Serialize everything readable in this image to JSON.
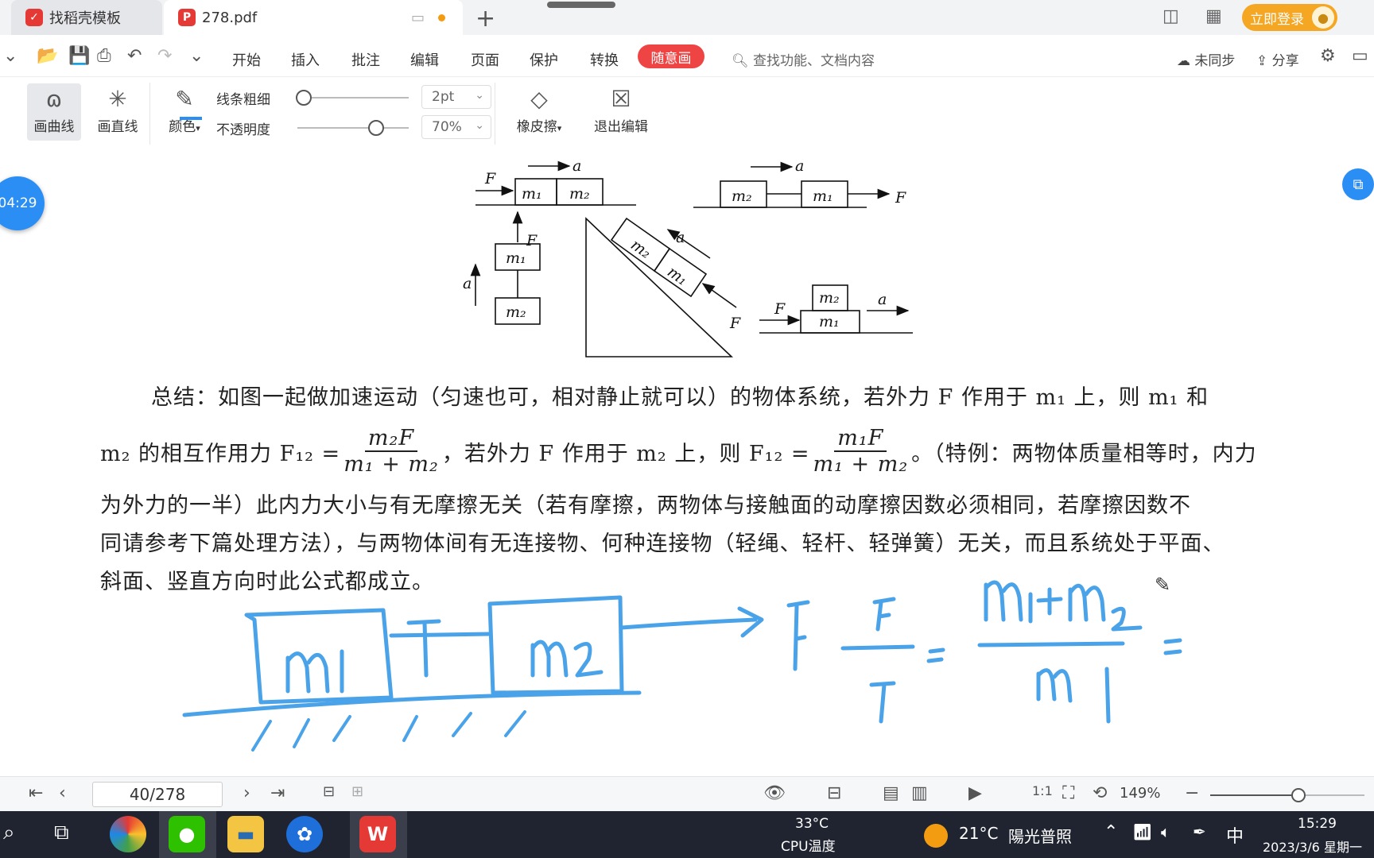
{
  "tabs": [
    {
      "label": "找稻壳模板",
      "icon": "docer-icon"
    },
    {
      "label": "278.pdf",
      "icon": "pdf-icon"
    }
  ],
  "login_label": "立即登录",
  "menu": {
    "items": [
      "开始",
      "插入",
      "批注",
      "编辑",
      "页面",
      "保护",
      "转换"
    ],
    "active": "随意画",
    "search_placeholder": "查找功能、文档内容",
    "sync_label": "未同步",
    "share_label": "分享"
  },
  "ribbon": {
    "curve_label": "画曲线",
    "line_label": "画直线",
    "color_label": "颜色",
    "thickness_label": "线条粗细",
    "thickness_value": "2pt",
    "thickness_level": 0.05,
    "opacity_label": "不透明度",
    "opacity_value": "70%",
    "opacity_level": 0.7,
    "eraser_label": "橡皮擦",
    "exit_label": "退出编辑"
  },
  "timer": "04:29",
  "document": {
    "para_summary": "总结：如图一起做加速运动（匀速也可，相对静止就可以）的物体系统，若外力 F 作用于 m₁ 上，则 m₁ 和",
    "para_line2_a": "m₂ 的相互作用力 F₁₂ =",
    "frac1_num": "m₂F",
    "frac1_den": "m₁ + m₂",
    "para_line2_b": "，若外力 F 作用于 m₂ 上，则 F₁₂ =",
    "frac2_num": "m₁F",
    "frac2_den": "m₁ + m₂",
    "para_line2_c": "。（特例：两物体质量相等时，内力",
    "para_line3": "为外力的一半）此内力大小与有无摩擦无关（若有摩擦，两物体与接触面的动摩擦因数必须相同，若摩擦因数不",
    "para_line4": "同请参考下篇处理方法），与两物体间有无连接物、何种连接物（轻绳、轻杆、轻弹簧）无关，而且系统处于平面、",
    "para_line5": "斜面、竖直方向时此公式都成立。",
    "diagram_labels": {
      "F": "F",
      "a": "a",
      "m1": "m₁",
      "m2": "m₂"
    }
  },
  "status": {
    "page": "40/278",
    "zoom": "149%",
    "zoom_level": 0.57
  },
  "taskbar": {
    "temp_value": "33°C",
    "temp_label": "CPU温度",
    "weather_temp": "21°C",
    "weather_desc": "陽光普照",
    "ime": "中",
    "time": "15:29",
    "date": "2023/3/6 星期一"
  },
  "colors": {
    "accent": "#ef4444",
    "login": "#f5a623",
    "ink": "#4aa3e8",
    "timer": "#2b8ef5"
  }
}
